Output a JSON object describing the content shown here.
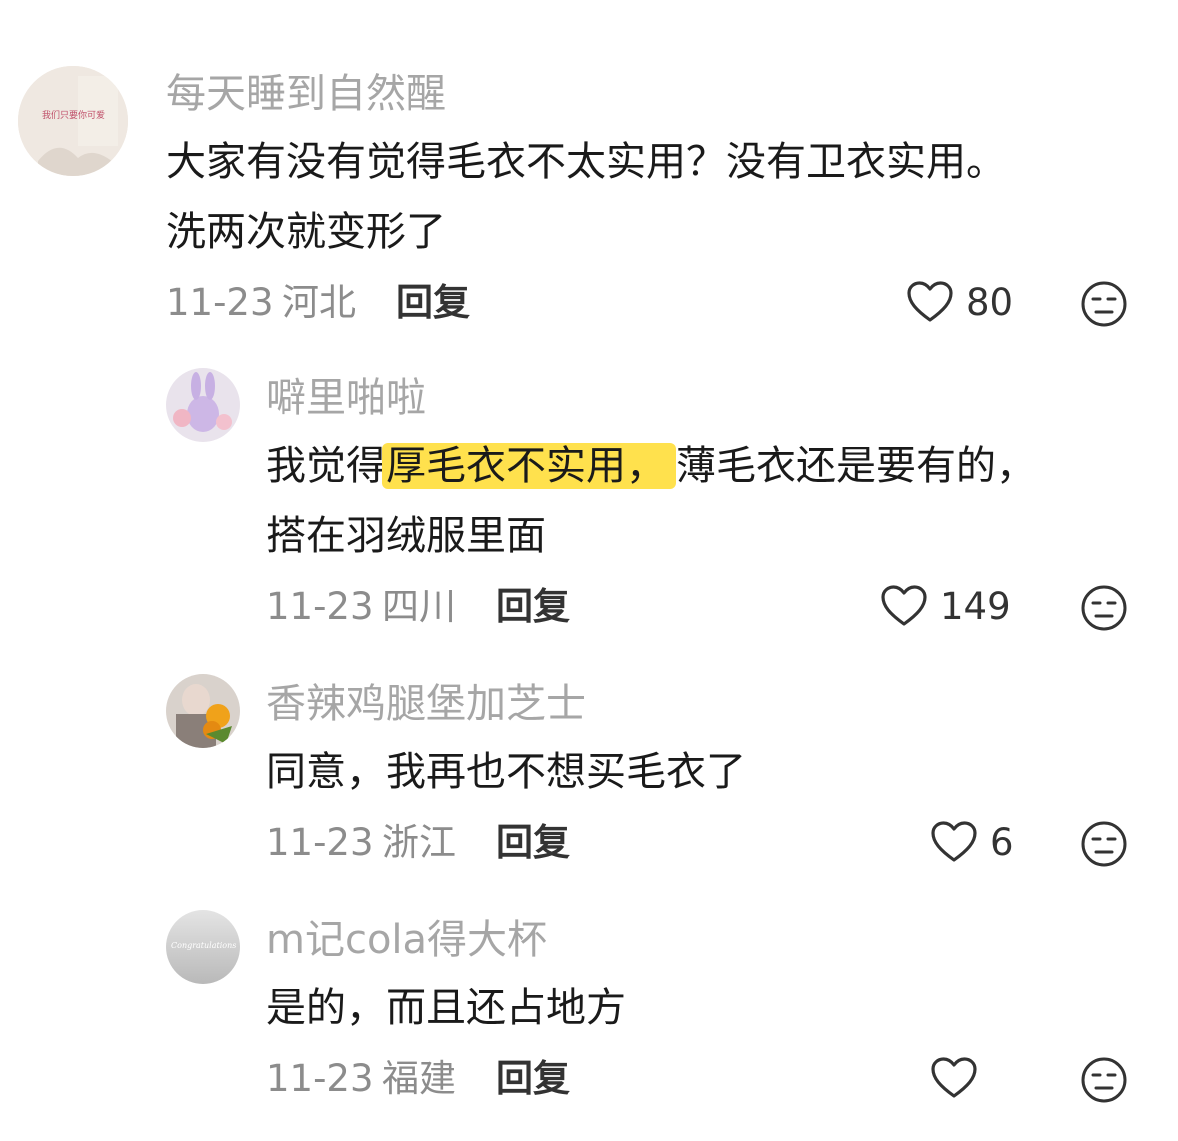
{
  "comments": [
    {
      "username": "每天睡到自然醒",
      "avatar_text": "我们只要你可爱",
      "line1": "大家有没有觉得毛衣不太实用？没有卫衣实用。",
      "line2": "洗两次就变形了",
      "date": "11-23",
      "location": "河北",
      "reply_label": "回复",
      "likes": "80"
    },
    {
      "username": "噼里啪啦",
      "line1_before": "我觉得",
      "line1_highlight": "厚毛衣不实用，",
      "line1_after": "薄毛衣还是要有的，",
      "line2": "搭在羽绒服里面",
      "date": "11-23",
      "location": "四川",
      "reply_label": "回复",
      "likes": "149"
    },
    {
      "username": "香辣鸡腿堡加芝士",
      "line1": "同意，我再也不想买毛衣了",
      "date": "11-23",
      "location": "浙江",
      "reply_label": "回复",
      "likes": "6"
    },
    {
      "username": "m记cola得大杯",
      "avatar_text": "Congratulations",
      "line1": "是的，而且还占地方",
      "date": "11-23",
      "location": "福建",
      "reply_label": "回复",
      "likes": ""
    }
  ],
  "colors": {
    "highlight": "#ffe14d",
    "username": "#a6a6a6",
    "text": "#1a1a1a",
    "meta": "#8c8c8c"
  },
  "icons": {
    "like": "heart-outline-icon",
    "dislike": "unamused-face-icon"
  }
}
